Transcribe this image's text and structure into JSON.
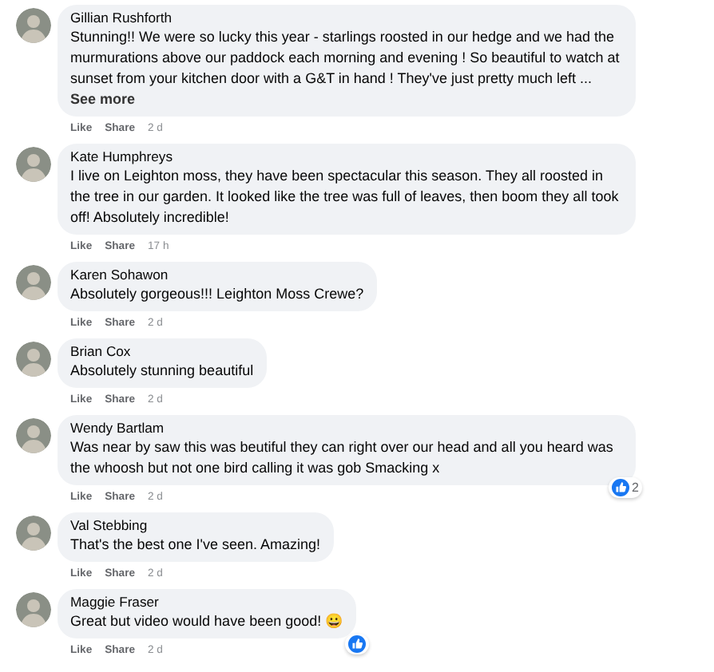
{
  "comments": [
    {
      "author": "Gillian Rushforth",
      "text": "Stunning!! We were so lucky this year - starlings roosted in our hedge and we had the murmurations above our paddock each morning and evening ! So beautiful to watch at sunset from your kitchen door with a G&T in hand ! They've just pretty much left ...",
      "see_more": "See more",
      "actions": [
        "Like",
        "Share"
      ],
      "time": "2 d"
    },
    {
      "author": "Kate Humphreys",
      "text": "I live on Leighton moss, they have been spectacular this season. They all roosted in the tree in our garden. It looked like the tree was full of leaves, then boom they all took off! Absolutely incredible!",
      "actions": [
        "Like",
        "Share"
      ],
      "time": "17 h"
    },
    {
      "author": "Karen Sohawon",
      "text": "Absolutely gorgeous!!! Leighton Moss Crewe?",
      "actions": [
        "Like",
        "Share"
      ],
      "time": "2 d"
    },
    {
      "author": "Brian Cox",
      "text": "Absolutely stunning beautiful",
      "actions": [
        "Like",
        "Share"
      ],
      "time": "2 d"
    },
    {
      "author": "Wendy Bartlam",
      "text": "Was near by saw this was beutiful they can right over our head and all you heard was the whoosh but not one bird calling it was gob Smacking x",
      "actions": [
        "Like",
        "Share"
      ],
      "time": "2 d",
      "reaction": {
        "kind": "like",
        "count": "2"
      }
    },
    {
      "author": "Val Stebbing",
      "text": "That's the best one I've seen. Amazing!",
      "actions": [
        "Like",
        "Share"
      ],
      "time": "2 d"
    },
    {
      "author": "Maggie Fraser",
      "text": "Great but video would have been good! 😀",
      "actions": [
        "Like",
        "Share"
      ],
      "time": "2 d",
      "reaction": {
        "kind": "like"
      }
    }
  ]
}
